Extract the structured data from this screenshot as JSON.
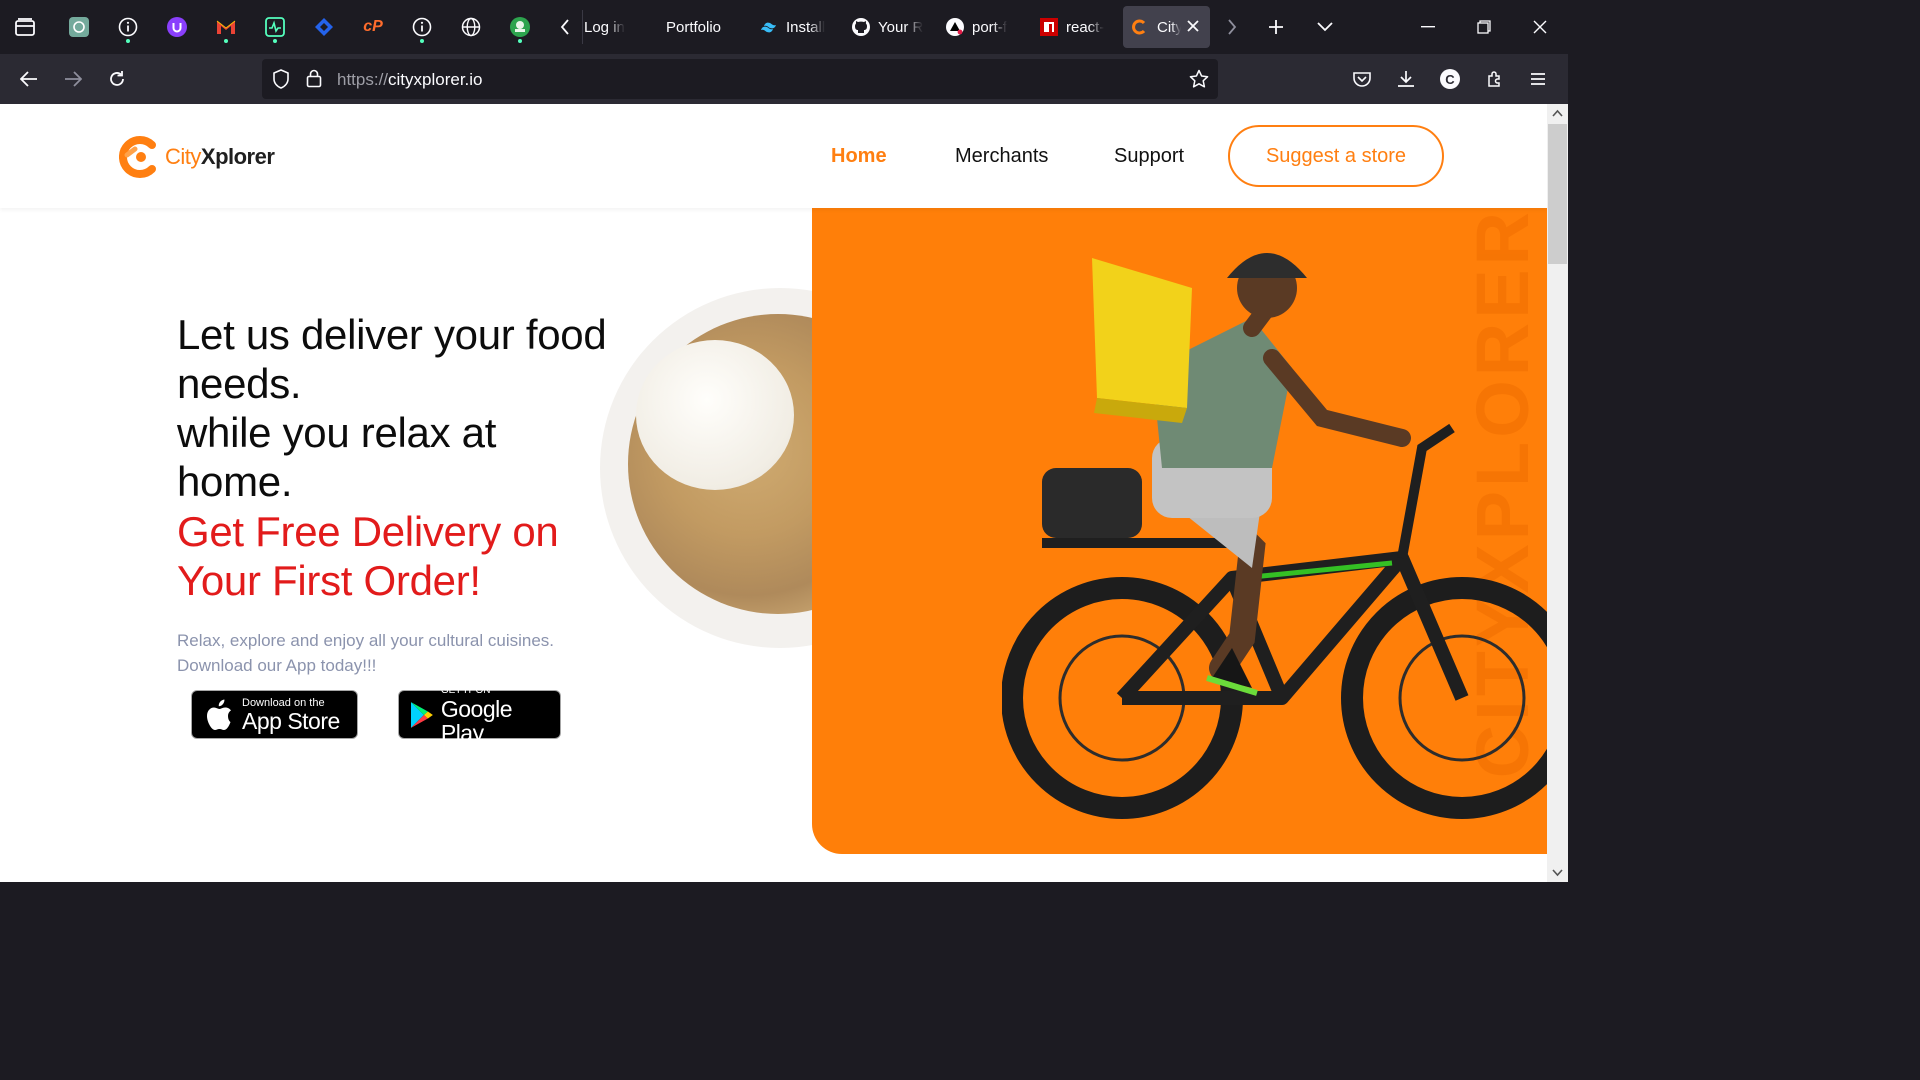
{
  "browser": {
    "tabs": [
      {
        "label": "Log in"
      },
      {
        "label": "Portfolio"
      },
      {
        "label": "Install"
      },
      {
        "label": "Your R"
      },
      {
        "label": "port-f"
      },
      {
        "label": "react-"
      },
      {
        "label": "City"
      }
    ],
    "url_scheme": "https://",
    "url_host": "cityxplorer.io",
    "profile_initial": "C"
  },
  "site": {
    "logo_city": "City",
    "logo_xplorer": "Xplorer",
    "nav": {
      "home": "Home",
      "merchants": "Merchants",
      "support": "Support"
    },
    "cta": "Suggest a store",
    "brand_vertical": "CITYXPLORER",
    "headline_1": "Let us deliver your food needs.",
    "headline_2": "while you relax at home.",
    "promo": "Get Free Delivery on Your First Order!",
    "subtext": "Relax, explore and enjoy all your cultural cuisines. Download our App today!!!",
    "appstore_small": "Download on the",
    "appstore_big": "App Store",
    "googleplay_small": "GET IT ON",
    "googleplay_big": "Google Play"
  },
  "colors": {
    "accent": "#ff7f11",
    "promo": "#e21b1b",
    "hero_bg": "#ff7f09"
  }
}
